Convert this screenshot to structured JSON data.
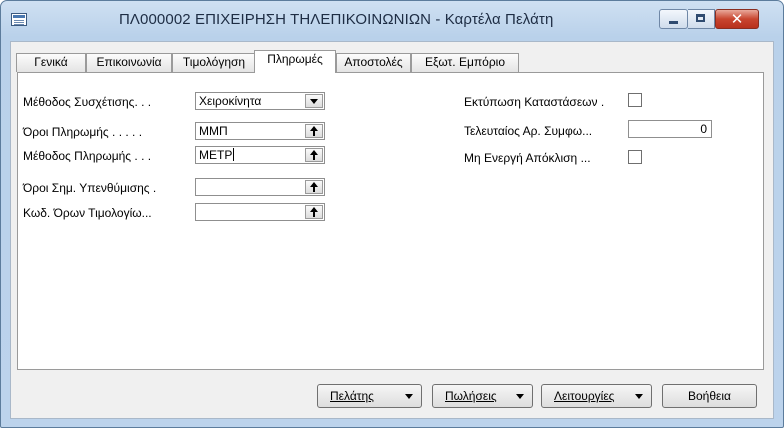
{
  "window": {
    "title": "ΠΛ000002 ΕΠΙΧΕΙΡΗΣΗ ΤΗΛΕΠΙΚΟΙΝΩΝΙΩΝ - Καρτέλα Πελάτη",
    "close_glyph": "✕"
  },
  "tabs": [
    "Γενικά",
    "Επικοινωνία",
    "Τιμολόγηση",
    "Πληρωμές",
    "Αποστολές",
    "Εξωτ. Εμπόριο"
  ],
  "active_tab": "Πληρωμές",
  "left_fields": {
    "application_method": {
      "label": "Μέθοδος Συσχέτισης. . .",
      "value": "Χειροκίνητα"
    },
    "payment_terms": {
      "label": "Όροι Πληρωμής . . . . .",
      "value": "ΜΜΠ"
    },
    "payment_method": {
      "label": "Μέθοδος Πληρωμής . . .",
      "value": "ΜΕΤΡ"
    },
    "reminder_terms": {
      "label": "Όροι Σημ. Υπενθύμισης .",
      "value": ""
    },
    "fin_charge_terms": {
      "label": "Κωδ. Όρων Τιμολογίω...",
      "value": ""
    }
  },
  "right_fields": {
    "print_statements": {
      "label": "Εκτύπωση Καταστάσεων .",
      "checked": false
    },
    "last_statement_no": {
      "label": "Τελευταίος Αρ. Συμφω...",
      "value": "0"
    },
    "block_payment_tolerance": {
      "label": "Μη Ενεργή Απόκλιση ...",
      "checked": false
    }
  },
  "buttons": {
    "customer": "Πελάτης",
    "sales": "Πωλήσεις",
    "functions": "Λειτουργίες",
    "help": "Βοήθεια"
  }
}
